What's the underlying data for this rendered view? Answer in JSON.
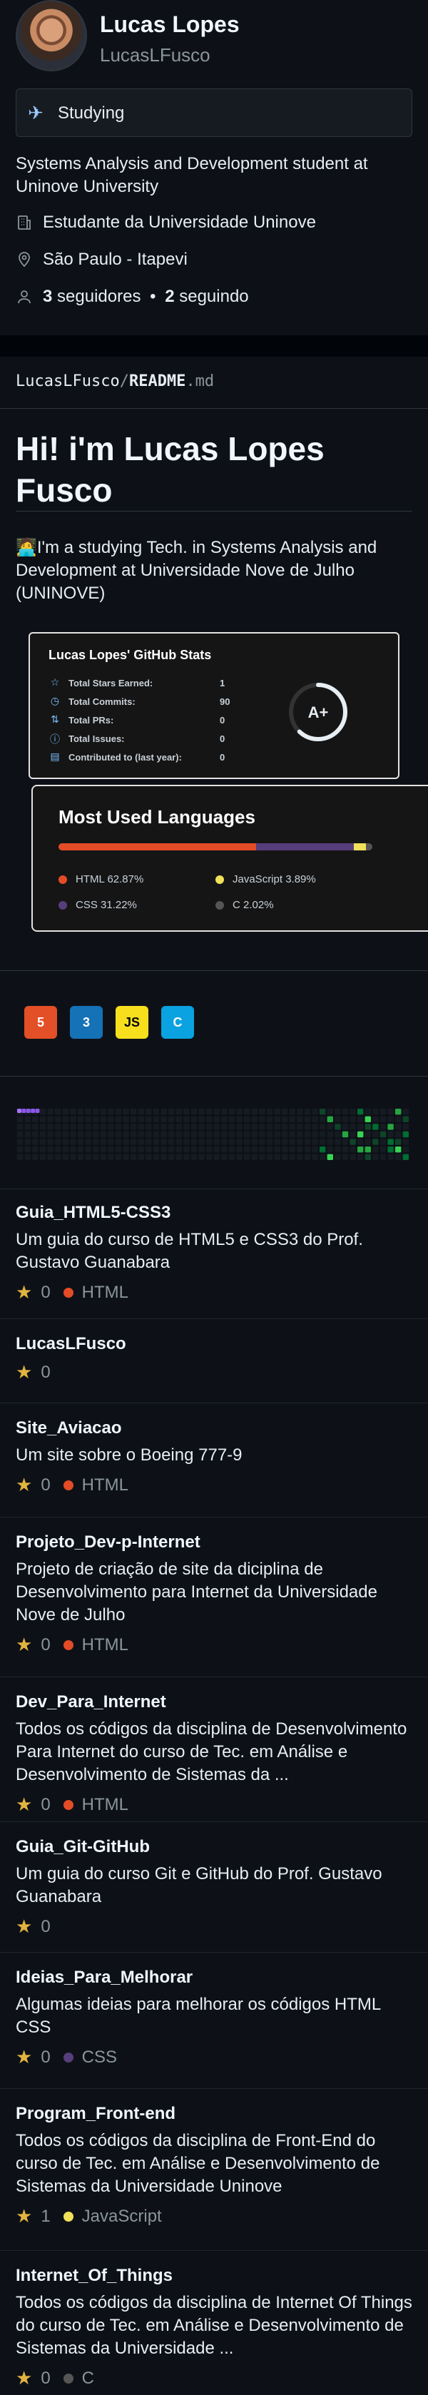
{
  "profile": {
    "name": "Lucas Lopes",
    "username": "LucasLFusco",
    "status_text": "Studying",
    "status_icon": "airplane-icon",
    "bio": "Systems Analysis and Development student at Uninove University",
    "company": "Estudante da Universidade Uninove",
    "location": "São Paulo - Itapevi",
    "followers_count": "3",
    "followers_label": "seguidores",
    "following_count": "2",
    "following_label": "seguindo",
    "separator": "•"
  },
  "readme": {
    "path_user": "LucasLFusco",
    "path_slash": "/",
    "path_file": "README",
    "path_ext": ".md",
    "heading": "Hi! i'm Lucas Lopes Fusco",
    "intro_emoji": "🧑‍💻",
    "intro": "I'm a studying Tech. in Systems Analysis and Development at Universidade Nove de Julho (UNINOVE)"
  },
  "stats_card": {
    "title": "Lucas Lopes' GitHub Stats",
    "rows": [
      {
        "label": "Total Stars Earned:",
        "value": "1",
        "icon": "star-icon"
      },
      {
        "label": "Total Commits:",
        "value": "90",
        "icon": "clock-icon"
      },
      {
        "label": "Total PRs:",
        "value": "0",
        "icon": "pull-request-icon"
      },
      {
        "label": "Total Issues:",
        "value": "0",
        "icon": "issue-icon"
      },
      {
        "label": "Contributed to (last year):",
        "value": "0",
        "icon": "repo-icon"
      }
    ],
    "grade": "A+",
    "grade_progress": 0.62,
    "accent": "#79c0ff"
  },
  "languages_card": {
    "title": "Most Used Languages",
    "languages": [
      {
        "name": "HTML",
        "percent": 62.87,
        "label": "HTML 62.87%",
        "color": "#e34c26"
      },
      {
        "name": "CSS",
        "percent": 31.22,
        "label": "CSS 31.22%",
        "color": "#563d7c"
      },
      {
        "name": "JavaScript",
        "percent": 3.89,
        "label": "JavaScript 3.89%",
        "color": "#f1e05a"
      },
      {
        "name": "C",
        "percent": 2.02,
        "label": "C 2.02%",
        "color": "#555555"
      }
    ]
  },
  "tech_icons": [
    {
      "name": "html5-icon",
      "text": "5",
      "color": "#e34f26"
    },
    {
      "name": "css3-icon",
      "text": "3",
      "color": "#1572b6"
    },
    {
      "name": "javascript-icon",
      "text": "JS",
      "color": "#f7df1e"
    },
    {
      "name": "c-icon",
      "text": "C",
      "color": "#0aa2e0"
    }
  ],
  "repos": [
    {
      "name": "Guia_HTML5-CSS3",
      "desc": "Um guia do curso de HTML5 e CSS3 do Prof. Gustavo Guanabara",
      "stars": "0",
      "lang": "HTML",
      "lang_color": "#e34c26"
    },
    {
      "name": "LucasLFusco",
      "desc": "",
      "stars": "0",
      "lang": "",
      "lang_color": ""
    },
    {
      "name": "Site_Aviacao",
      "desc": "Um site sobre o Boeing 777-9",
      "stars": "0",
      "lang": "HTML",
      "lang_color": "#e34c26"
    },
    {
      "name": "Projeto_Dev-p-Internet",
      "desc": "Projeto de criação de site da diciplina de Desenvolvimento para Internet da Universidade Nove de Julho",
      "stars": "0",
      "lang": "HTML",
      "lang_color": "#e34c26"
    },
    {
      "name": "Dev_Para_Internet",
      "desc": "Todos os códigos da disciplina de Desenvolvimento Para Internet do curso de Tec. em Análise e Desenvolvimento de Sistemas da ...",
      "stars": "0",
      "lang": "HTML",
      "lang_color": "#e34c26"
    },
    {
      "name": "Guia_Git-GitHub",
      "desc": "Um guia do curso Git e GitHub do Prof. Gustavo Guanabara",
      "stars": "0",
      "lang": "",
      "lang_color": ""
    },
    {
      "name": "Ideias_Para_Melhorar",
      "desc": "Algumas ideias para melhorar os códigos HTML CSS",
      "stars": "0",
      "lang": "CSS",
      "lang_color": "#563d7c"
    },
    {
      "name": "Program_Front-end",
      "desc": "Todos os códigos da disciplina de Front-End do curso de Tec. em Análise e Desenvolvimento de Sistemas da Universidade Uninove",
      "stars": "1",
      "lang": "JavaScript",
      "lang_color": "#f1e05a"
    },
    {
      "name": "Internet_Of_Things",
      "desc": "Todos os códigos da disciplina de Internet Of Things do curso de Tec. em Análise e Desenvolvimento de Sistemas da Universidade ...",
      "stars": "0",
      "lang": "C",
      "lang_color": "#555555"
    }
  ]
}
